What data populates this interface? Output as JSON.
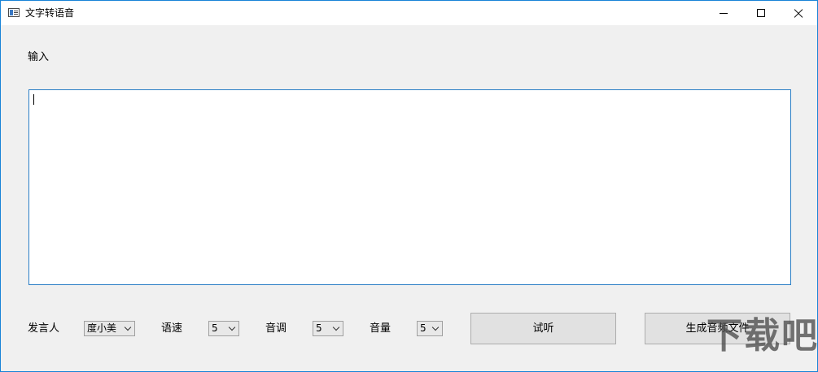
{
  "window": {
    "title": "文字转语音",
    "accent_color": "#1883d7"
  },
  "input": {
    "label": "输入",
    "value": ""
  },
  "controls": {
    "speaker_label": "发言人",
    "speaker_value": "度小美",
    "speed_label": "语速",
    "speed_value": "5",
    "pitch_label": "音调",
    "pitch_value": "5",
    "volume_label": "音量",
    "volume_value": "5"
  },
  "buttons": {
    "preview_label": "试听",
    "generate_label": "生成音频文件"
  },
  "watermark": {
    "text": "下载吧"
  }
}
